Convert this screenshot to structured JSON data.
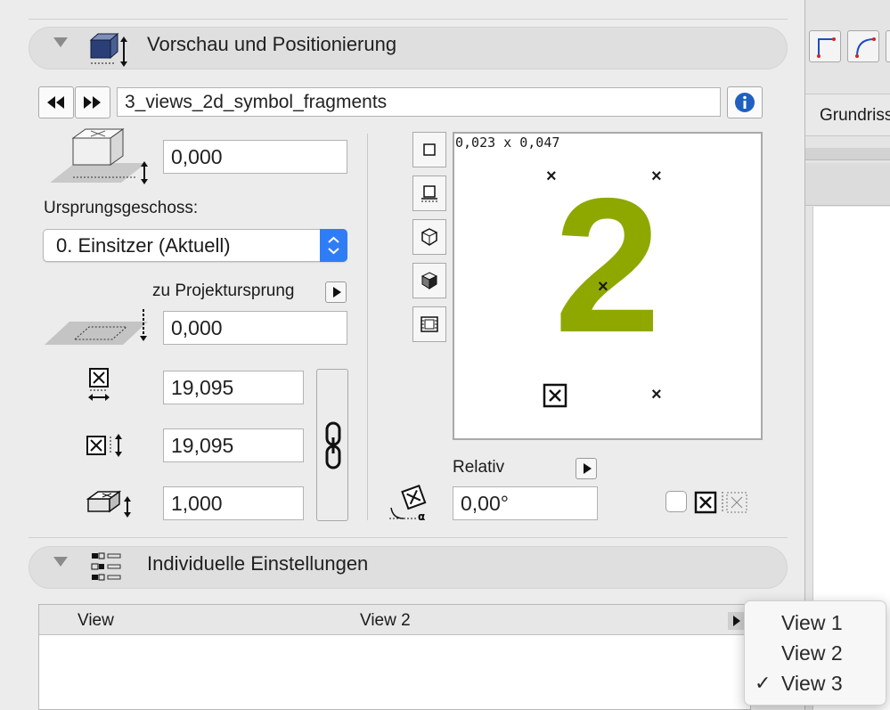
{
  "preview_section": {
    "title": "Vorschau und Positionierung",
    "object_name": "3_views_2d_symbol_fragments",
    "elevation_value": "0,000",
    "home_story_label": "Ursprungsgeschoss:",
    "home_story_value": "0. Einsitzer (Aktuell)",
    "relative_to_label": "zu Projektursprung",
    "offset_value": "0,000",
    "width_value": "19,095",
    "depth_value": "19,095",
    "height_value": "1,000",
    "preview_size": "0,023 x 0,047",
    "preview_symbol": "2",
    "preview_symbol_color": "#8fa800",
    "rotation_label": "Relativ",
    "rotation_value": "0,00°"
  },
  "custom_section": {
    "title": "Individuelle Einstellungen",
    "table": {
      "column_header": "View",
      "value_header": "View 2"
    }
  },
  "popup_menu": {
    "items": [
      {
        "label": "View 1",
        "checked": false
      },
      {
        "label": "View 2",
        "checked": false
      },
      {
        "label": "View 3",
        "checked": true
      }
    ],
    "checkmark": "✓"
  },
  "background_window": {
    "tab_label": "Grundriss"
  },
  "icons": {
    "prev": "rewind-icon",
    "next": "fast-forward-icon",
    "info": "info-icon",
    "link": "chain-link-icon"
  },
  "colors": {
    "accent_blue": "#2f7df6",
    "info_blue": "#1f5fbf",
    "symbol_green": "#8fa800"
  }
}
